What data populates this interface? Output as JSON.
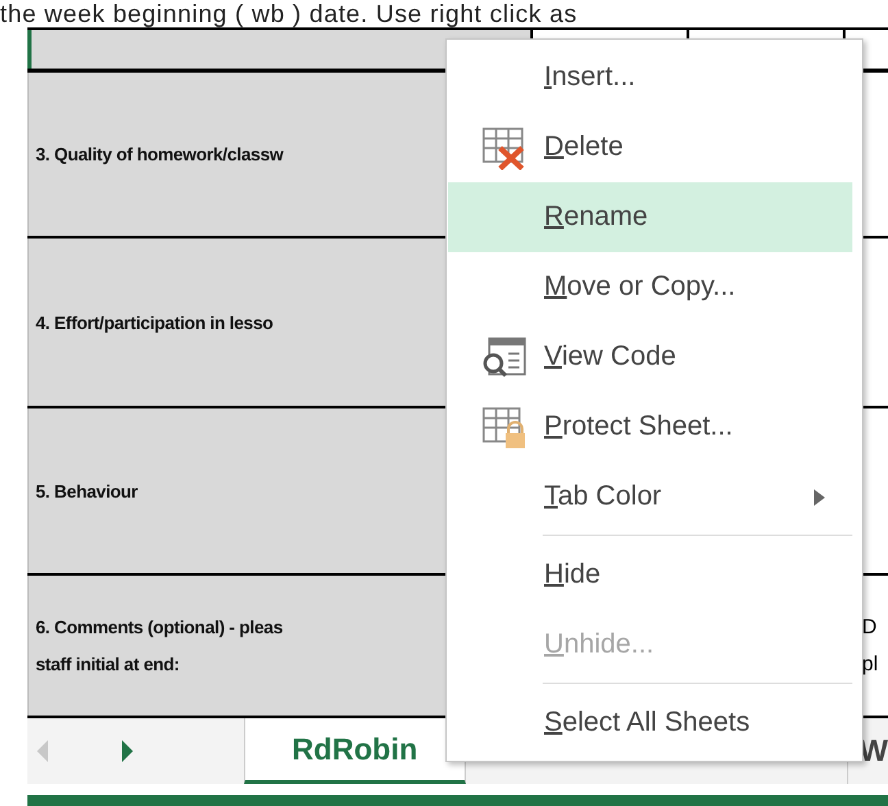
{
  "intro_text": "the week beginning ( wb ) date. Use right click as",
  "rows": [
    {
      "lines": [],
      "selected": true
    },
    {
      "lines": [
        "3. Quality of homework/classw"
      ],
      "selected": false
    },
    {
      "lines": [
        "4. Effort/participation in lesso"
      ],
      "selected": false
    },
    {
      "lines": [
        "5. Behaviour"
      ],
      "selected": false
    },
    {
      "lines": [
        "6. Comments (optional) - pleas",
        "staff initial at end:"
      ],
      "selected": false,
      "side_lines": [
        "D",
        "pl"
      ]
    }
  ],
  "context_menu": {
    "items": [
      {
        "kind": "item",
        "label": "Insert...",
        "disabled": false,
        "selected": false
      },
      {
        "kind": "item",
        "label": "Delete",
        "disabled": false,
        "selected": false
      },
      {
        "kind": "item",
        "label": "Rename",
        "disabled": false,
        "selected": true
      },
      {
        "kind": "item",
        "label": "Move or Copy...",
        "disabled": false,
        "selected": false
      },
      {
        "kind": "item",
        "label": "View Code",
        "disabled": false,
        "selected": false
      },
      {
        "kind": "item",
        "label": "Protect Sheet...",
        "disabled": false,
        "selected": false
      },
      {
        "kind": "submenu",
        "label": "Tab Color",
        "disabled": false,
        "selected": false
      },
      {
        "kind": "separator"
      },
      {
        "kind": "item",
        "label": "Hide",
        "disabled": false,
        "selected": false
      },
      {
        "kind": "item",
        "label": "Unhide...",
        "disabled": true,
        "selected": false
      },
      {
        "kind": "separator"
      },
      {
        "kind": "item",
        "label": "Select All Sheets",
        "disabled": false,
        "selected": false
      }
    ]
  },
  "sheet_tabs": {
    "scroll_left": {
      "disabled": true
    },
    "scroll_right": {
      "disabled": false
    },
    "tabs": [
      {
        "label": "RdRobin",
        "selected": true
      },
      {
        "label": "W",
        "selected": false
      }
    ]
  }
}
